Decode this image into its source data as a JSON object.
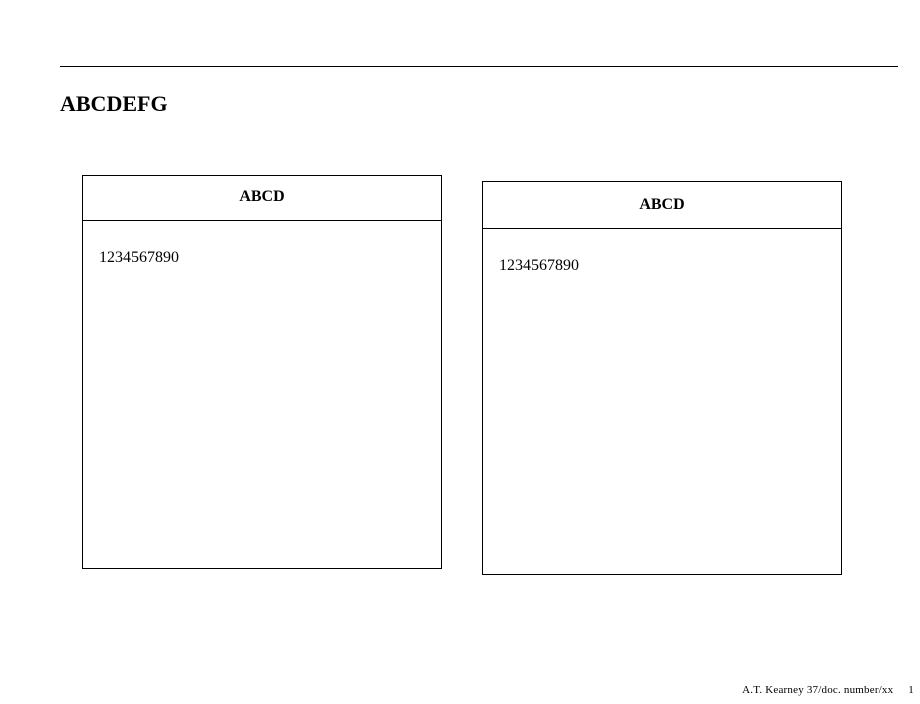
{
  "title": "ABCDEFG",
  "panels": {
    "left": {
      "header": "ABCD",
      "body": "1234567890"
    },
    "right": {
      "header": "ABCD",
      "body": "1234567890"
    }
  },
  "footer": {
    "text": "A.T. Kearney 37/doc. number/xx",
    "page": "1"
  }
}
